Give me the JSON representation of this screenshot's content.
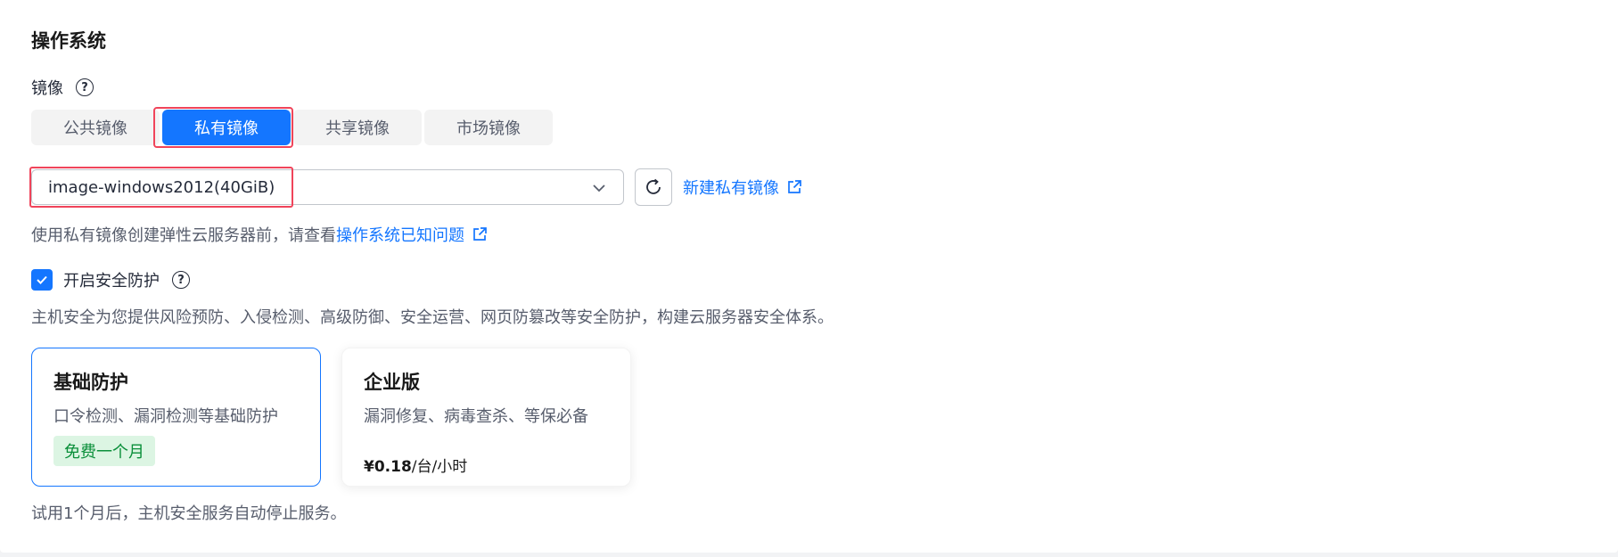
{
  "section": {
    "title": "操作系统"
  },
  "image_label": "镜像",
  "help_glyph": "?",
  "tabs": [
    {
      "label": "公共镜像",
      "active": false
    },
    {
      "label": "私有镜像",
      "active": true
    },
    {
      "label": "共享镜像",
      "active": false
    },
    {
      "label": "市场镜像",
      "active": false
    }
  ],
  "image_select": {
    "value": "image-windows2012(40GiB)"
  },
  "create_link": "新建私有镜像",
  "hint": {
    "prefix": "使用私有镜像创建弹性云服务器前，请查看",
    "link": "操作系统已知问题"
  },
  "security": {
    "checkbox_label": "开启安全防护",
    "checked": true,
    "description": "主机安全为您提供风险预防、入侵检测、高级防御、安全运营、网页防篡改等安全防护，构建云服务器安全体系。"
  },
  "cards": [
    {
      "title": "基础防护",
      "subtitle": "口令检测、漏洞检测等基础防护",
      "badge": "免费一个月",
      "selected": true
    },
    {
      "title": "企业版",
      "subtitle": "漏洞修复、病毒查杀、等保必备",
      "price_value": "¥0.18",
      "price_unit": "/台/小时",
      "selected": false
    }
  ],
  "footer_note": "试用1个月后，主机安全服务自动停止服务。",
  "colors": {
    "accent": "#1476ff",
    "highlight": "#f0445a",
    "badge_bg": "#dcf5e3",
    "badge_text": "#0a8f3a"
  }
}
